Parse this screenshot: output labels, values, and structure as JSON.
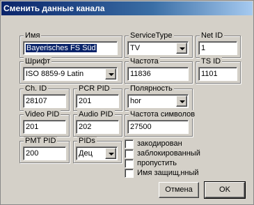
{
  "window": {
    "title": "Сменить данные канала"
  },
  "fields": {
    "name": {
      "label": "Имя",
      "value": "Bayerisches FS Süd"
    },
    "servicetype": {
      "label": "ServiceType",
      "value": "TV"
    },
    "net_id": {
      "label": "Net ID",
      "value": "1"
    },
    "font": {
      "label": "Шрифт",
      "value": "ISO 8859-9 Latin"
    },
    "frequency": {
      "label": "Частота",
      "value": "11836"
    },
    "ts_id": {
      "label": "TS ID",
      "value": "1101"
    },
    "ch_id": {
      "label": "Ch. ID",
      "value": "28107"
    },
    "pcr_pid": {
      "label": "PCR PID",
      "value": "201"
    },
    "polarity": {
      "label": "Полярность",
      "value": "hor"
    },
    "video_pid": {
      "label": "Video PID",
      "value": "201"
    },
    "audio_pid": {
      "label": "Audio PID",
      "value": "202"
    },
    "symbol_rate": {
      "label": "Частота символов",
      "value": "27500"
    },
    "pmt_pid": {
      "label": "PMT PID",
      "value": "200"
    },
    "pids": {
      "label": "PIDs",
      "value": "Дец"
    }
  },
  "checkboxes": {
    "encoded": {
      "label": "закодирован",
      "checked": false
    },
    "blocked": {
      "label": "заблокированный",
      "checked": false
    },
    "skip": {
      "label": "пропустить",
      "checked": false
    },
    "protected": {
      "label": "Имя защищ‚нный",
      "checked": false
    }
  },
  "buttons": {
    "cancel": "Отмена",
    "ok": "OK"
  }
}
